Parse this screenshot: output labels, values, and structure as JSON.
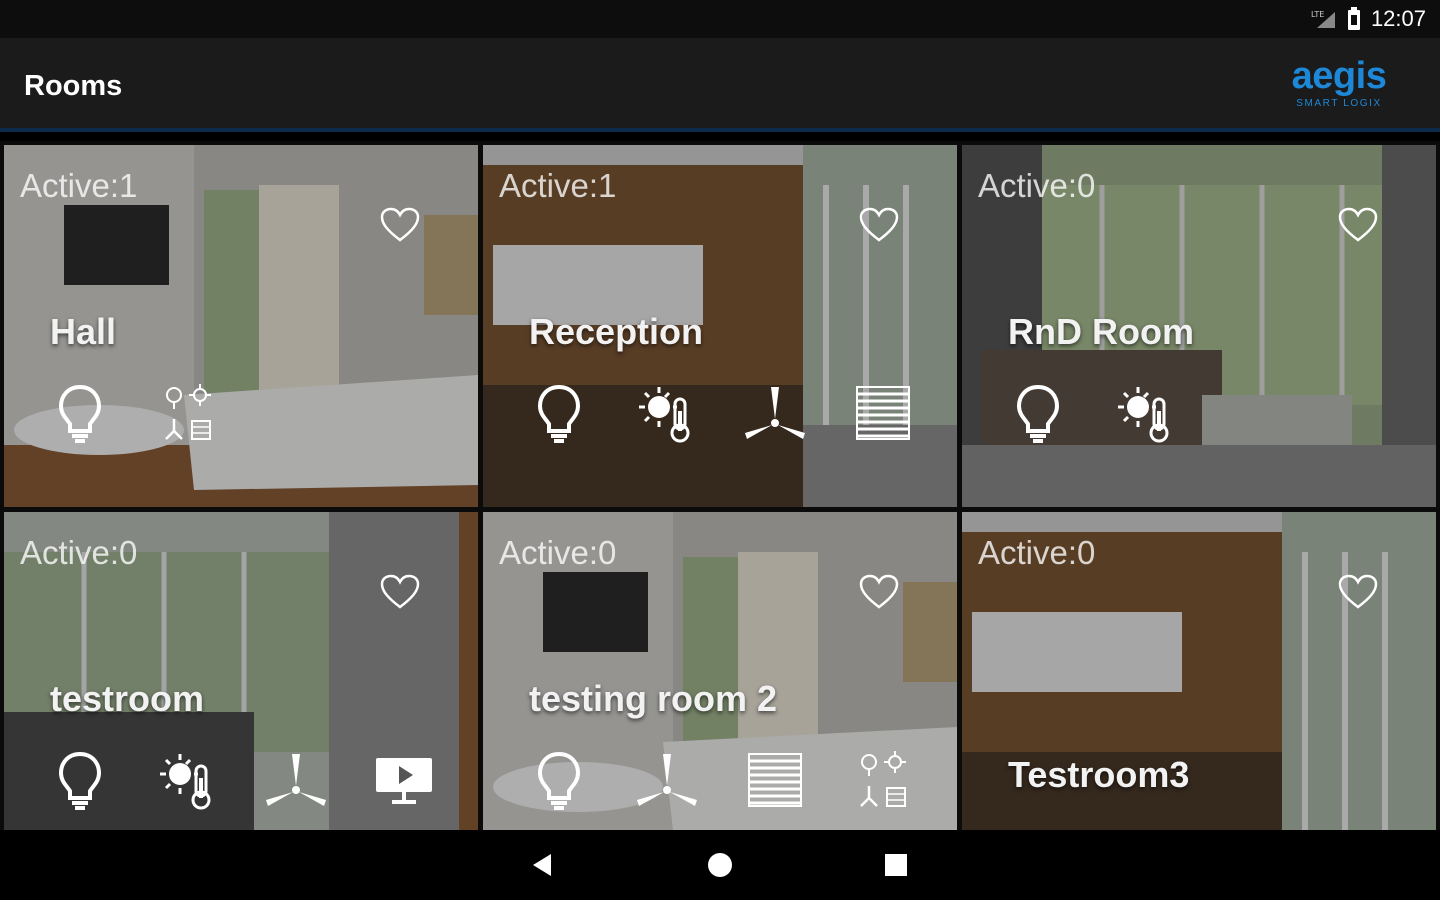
{
  "status": {
    "time": "12:07",
    "network_label": "LTE",
    "icons": [
      "signal-icon",
      "battery-icon"
    ]
  },
  "appbar": {
    "title": "Rooms",
    "logo_main": "aegis",
    "logo_sub": "SMART LOGIX"
  },
  "colors": {
    "accent": "#1e88d8",
    "appbar_bg": "#1b1b1b",
    "statusbar_bg": "#0d0d0d"
  },
  "rooms": [
    {
      "active": "Active:1",
      "name": "Hall",
      "devices": [
        "bulb-icon",
        "mixed-devices-icon"
      ]
    },
    {
      "active": "Active:1",
      "name": "Reception",
      "devices": [
        "bulb-icon",
        "temperature-icon",
        "fan-icon",
        "blinds-icon"
      ]
    },
    {
      "active": "Active:0",
      "name": "RnD Room",
      "devices": [
        "bulb-icon",
        "temperature-icon"
      ]
    },
    {
      "active": "Active:0",
      "name": "testroom",
      "devices": [
        "bulb-icon",
        "temperature-icon",
        "fan-icon",
        "tv-icon"
      ]
    },
    {
      "active": "Active:0",
      "name": "testing room 2",
      "devices": [
        "bulb-icon",
        "fan-icon",
        "blinds-icon",
        "mixed-devices-icon"
      ]
    },
    {
      "active": "Active:0",
      "name": "Testroom3",
      "devices": []
    }
  ],
  "nav": {
    "buttons": [
      "back-icon",
      "home-icon",
      "recents-icon"
    ]
  }
}
